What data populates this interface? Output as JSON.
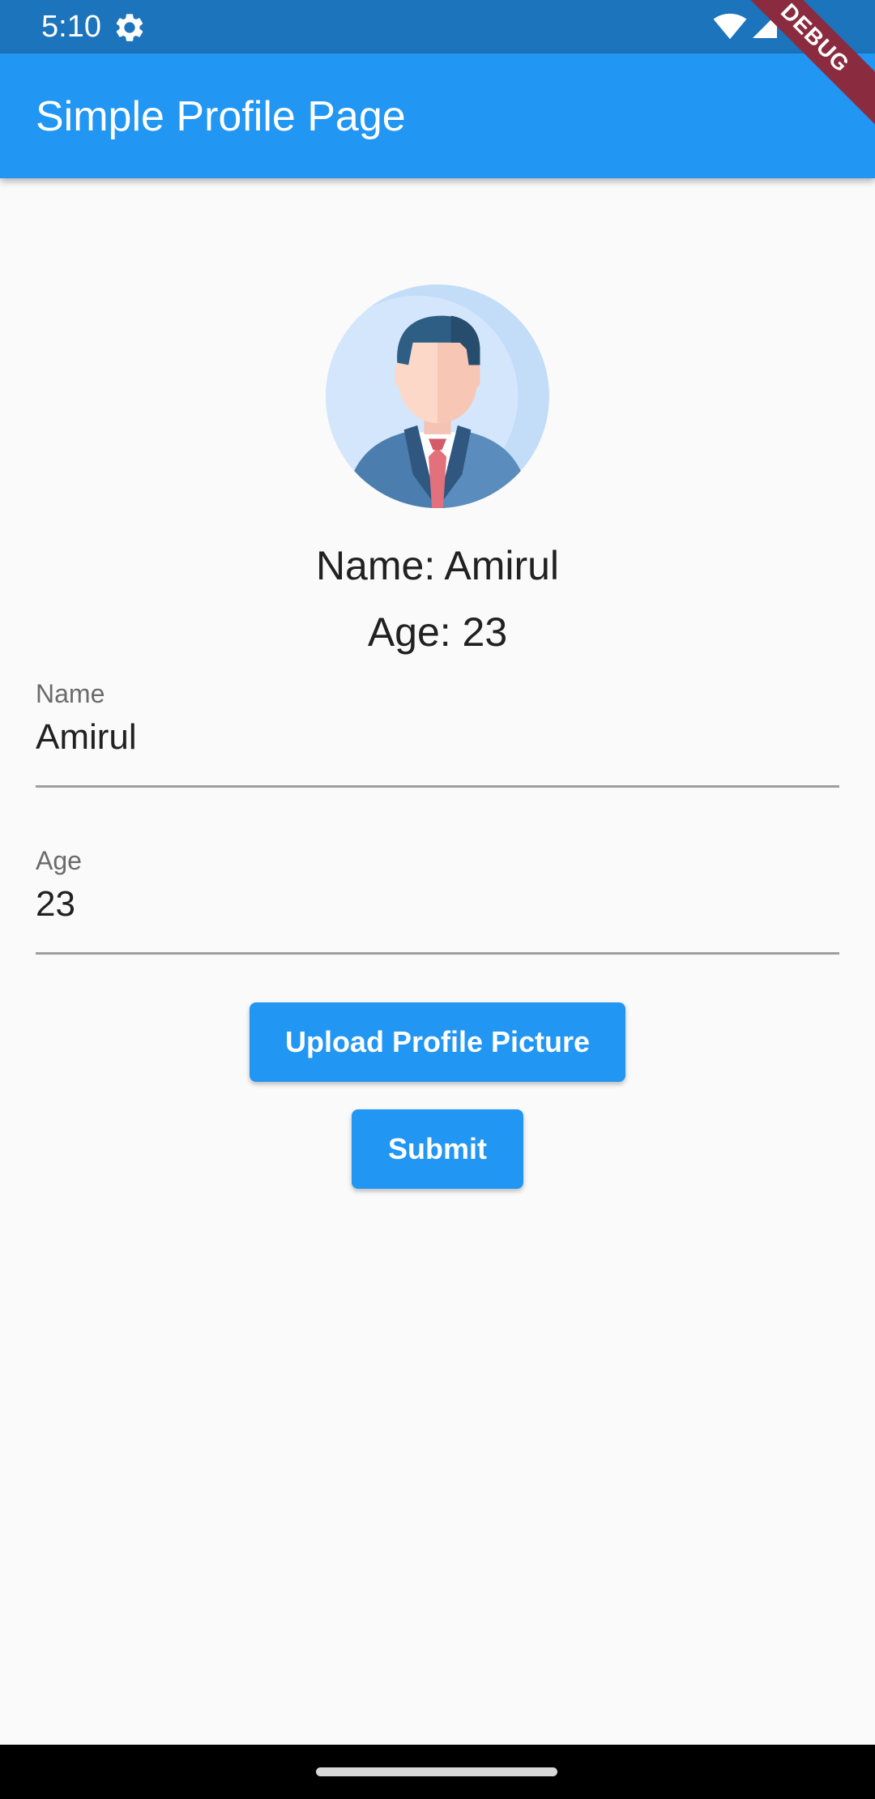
{
  "status_bar": {
    "time": "5:10",
    "icons": [
      "gear-icon",
      "wifi-icon",
      "signal-icon"
    ]
  },
  "app_bar": {
    "title": "Simple Profile Page"
  },
  "debug_banner": {
    "label": "DEBUG"
  },
  "profile": {
    "avatar_icon": "businessman-avatar-icon",
    "name_line": "Name: Amirul",
    "age_line": "Age: 23"
  },
  "form": {
    "name_label": "Name",
    "name_value": "Amirul",
    "age_label": "Age",
    "age_value": "23"
  },
  "buttons": {
    "upload_label": "Upload Profile Picture",
    "submit_label": "Submit"
  },
  "colors": {
    "primary": "#2196f3",
    "status_bar": "#1c74bc",
    "background": "#fafafa",
    "debug_banner": "#8b2b3f"
  }
}
